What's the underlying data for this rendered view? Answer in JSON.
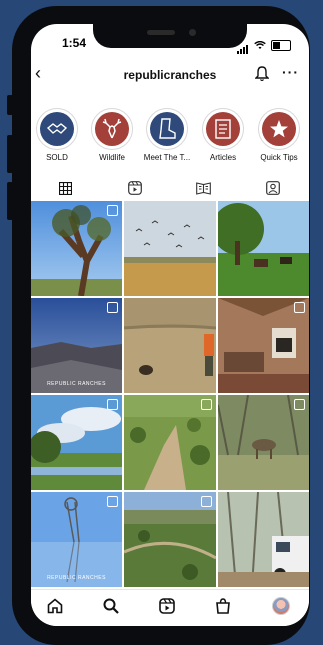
{
  "status": {
    "time": "1:54"
  },
  "header": {
    "username": "republicranches"
  },
  "highlights": [
    {
      "label": "SOLD",
      "icon": "handshake-icon",
      "color": "#2f4a7a"
    },
    {
      "label": "Wildlife",
      "icon": "deer-icon",
      "color": "#a3403a"
    },
    {
      "label": "Meet The T...",
      "icon": "boot-icon",
      "color": "#2f4a7a"
    },
    {
      "label": "Articles",
      "icon": "document-icon",
      "color": "#a3403a"
    },
    {
      "label": "Quick Tips",
      "icon": "star-icon",
      "color": "#a3403a"
    }
  ],
  "tabs": [
    "grid-icon",
    "reels-icon",
    "guides-icon",
    "tagged-icon"
  ],
  "posts": [
    {
      "name": "oak-tree-post",
      "badge": "reel"
    },
    {
      "name": "birds-over-field-post",
      "badge": "none"
    },
    {
      "name": "horses-in-pasture-post",
      "badge": "none"
    },
    {
      "name": "canyon-overlook-post",
      "badge": "multi",
      "caption": "REPUBLIC RANCHES"
    },
    {
      "name": "hunter-with-dog-post",
      "badge": "none"
    },
    {
      "name": "lodge-interior-post",
      "badge": "multi"
    },
    {
      "name": "creek-and-sky-post",
      "badge": "multi"
    },
    {
      "name": "aerial-ranch-post",
      "badge": "reel"
    },
    {
      "name": "deer-in-brush-post",
      "badge": "multi"
    },
    {
      "name": "windmill-reflection-post",
      "badge": "multi",
      "caption": "REPUBLIC RANCHES"
    },
    {
      "name": "aerial-farmland-post",
      "badge": "multi"
    },
    {
      "name": "truck-camping-post",
      "badge": "none"
    }
  ],
  "bottom_nav": [
    "home-icon",
    "search-icon",
    "reels-icon",
    "shop-icon",
    "profile-avatar"
  ]
}
